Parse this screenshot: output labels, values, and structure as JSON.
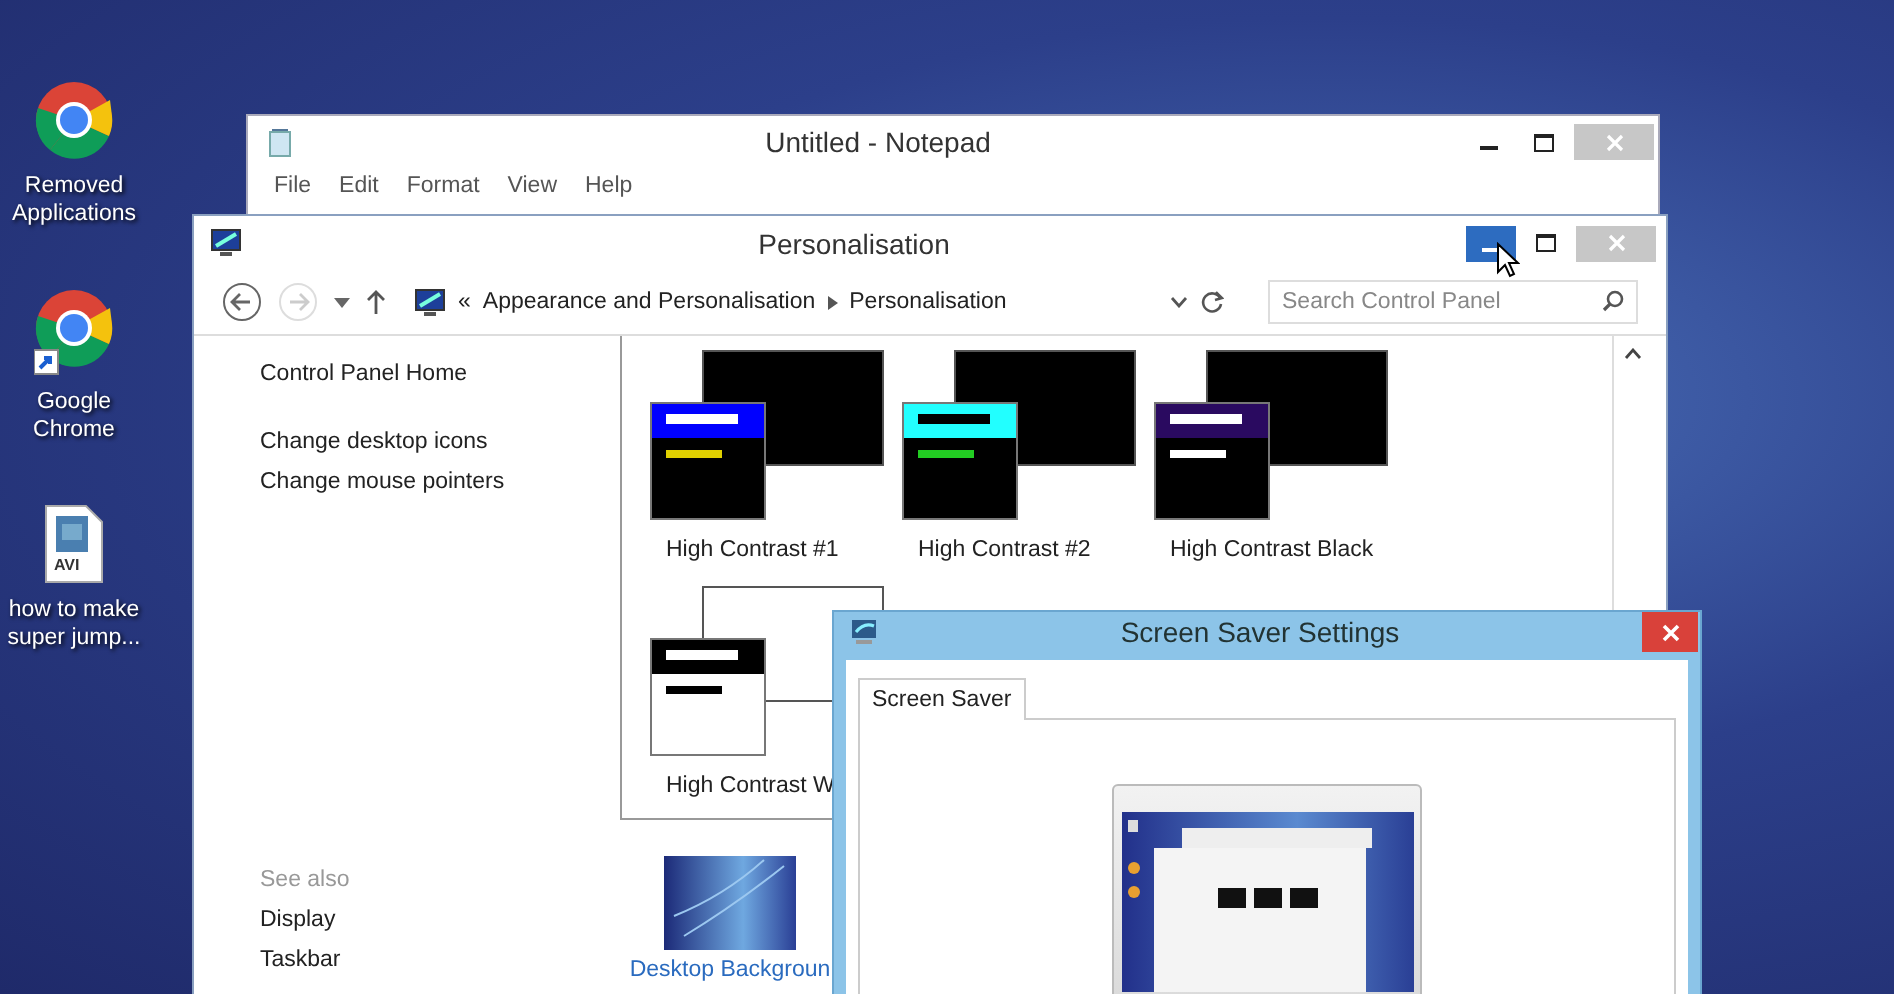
{
  "desktop_icons": [
    {
      "label": "Removed Applications",
      "kind": "chrome"
    },
    {
      "label": "Google Chrome",
      "kind": "chrome-shortcut"
    },
    {
      "label": "how to make super jump...",
      "kind": "video-file",
      "badge": "AVI"
    }
  ],
  "notepad": {
    "title": "Untitled - Notepad",
    "menu": [
      "File",
      "Edit",
      "Format",
      "View",
      "Help"
    ]
  },
  "personalisation": {
    "title": "Personalisation",
    "minimize_hovered": true,
    "breadcrumb": {
      "prefix": "«",
      "items": [
        "Appearance and Personalisation",
        "Personalisation"
      ]
    },
    "search": {
      "placeholder": "Search Control Panel"
    },
    "sidebar": {
      "links": [
        "Control Panel Home",
        "Change desktop icons",
        "Change mouse pointers"
      ],
      "see_also": {
        "heading": "See also",
        "links": [
          "Display",
          "Taskbar"
        ]
      }
    },
    "themes": [
      {
        "label": "High Contrast #1",
        "kind": "hc1"
      },
      {
        "label": "High Contrast #2",
        "kind": "hc2"
      },
      {
        "label": "High Contrast Black",
        "kind": "black"
      },
      {
        "label": "High Contrast W",
        "kind": "white"
      }
    ],
    "desktop_background": {
      "label": "Desktop Backgroun"
    }
  },
  "screen_saver": {
    "title": "Screen Saver Settings",
    "tabs": [
      {
        "label": "Screen Saver",
        "selected": true
      }
    ]
  }
}
